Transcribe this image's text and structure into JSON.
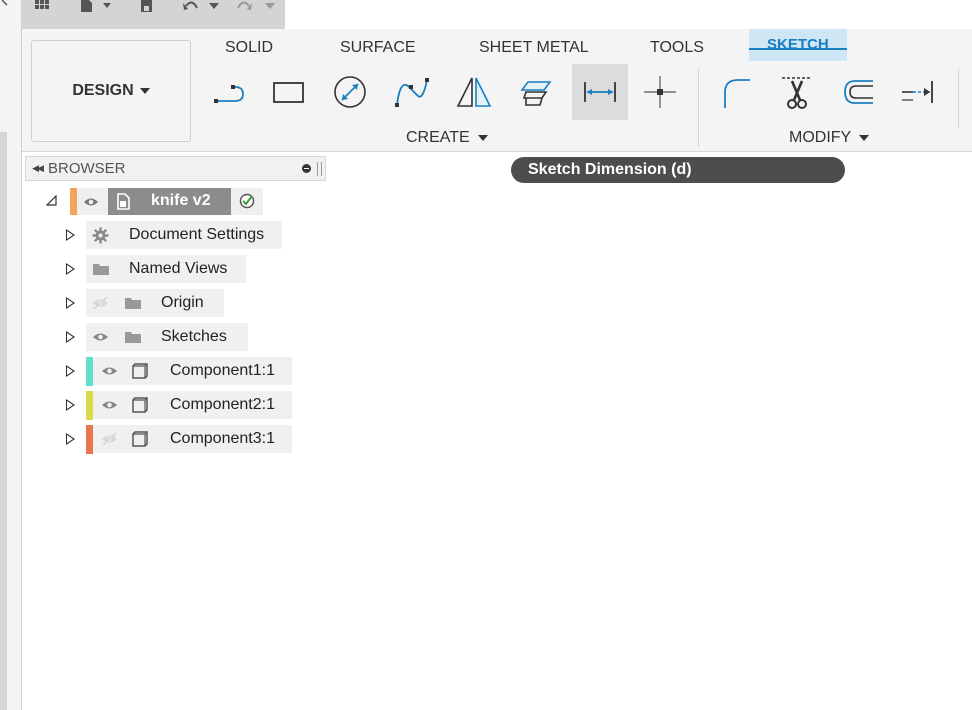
{
  "ribbon": {
    "workspace_label": "DESIGN",
    "tabs": [
      {
        "label": "SOLID"
      },
      {
        "label": "SURFACE"
      },
      {
        "label": "SHEET METAL"
      },
      {
        "label": "TOOLS"
      },
      {
        "label": "SKETCH"
      }
    ],
    "active_tab": "SKETCH",
    "groups": {
      "create": "CREATE",
      "modify": "MODIFY"
    }
  },
  "tooltip": {
    "text": "Sketch Dimension (d)"
  },
  "browser": {
    "title": "BROWSER",
    "root": {
      "name": "knife v2"
    },
    "items": [
      {
        "label": "Document Settings"
      },
      {
        "label": "Named Views"
      },
      {
        "label": "Origin"
      },
      {
        "label": "Sketches"
      },
      {
        "label": "Component1:1"
      },
      {
        "label": "Component2:1"
      },
      {
        "label": "Component3:1"
      }
    ]
  },
  "colors": {
    "accent": "#1a7fc1",
    "active_tab_bg": "#cfe6f5",
    "root_swatch": "#f5a25d",
    "component1": "#5fe0c8",
    "component2": "#d9d94a",
    "component3": "#e8764a"
  },
  "icons": {
    "quick_access": [
      "grid-icon",
      "file-icon",
      "save-icon",
      "undo-icon",
      "redo-icon"
    ],
    "create_tools": [
      "line-icon",
      "rectangle-icon",
      "circle-icon",
      "spline-icon",
      "mirror-icon",
      "project-icon",
      "sketch-dimension-icon",
      "point-icon"
    ],
    "modify_tools": [
      "fillet-icon",
      "trim-icon",
      "offset-icon",
      "extend-icon"
    ]
  }
}
